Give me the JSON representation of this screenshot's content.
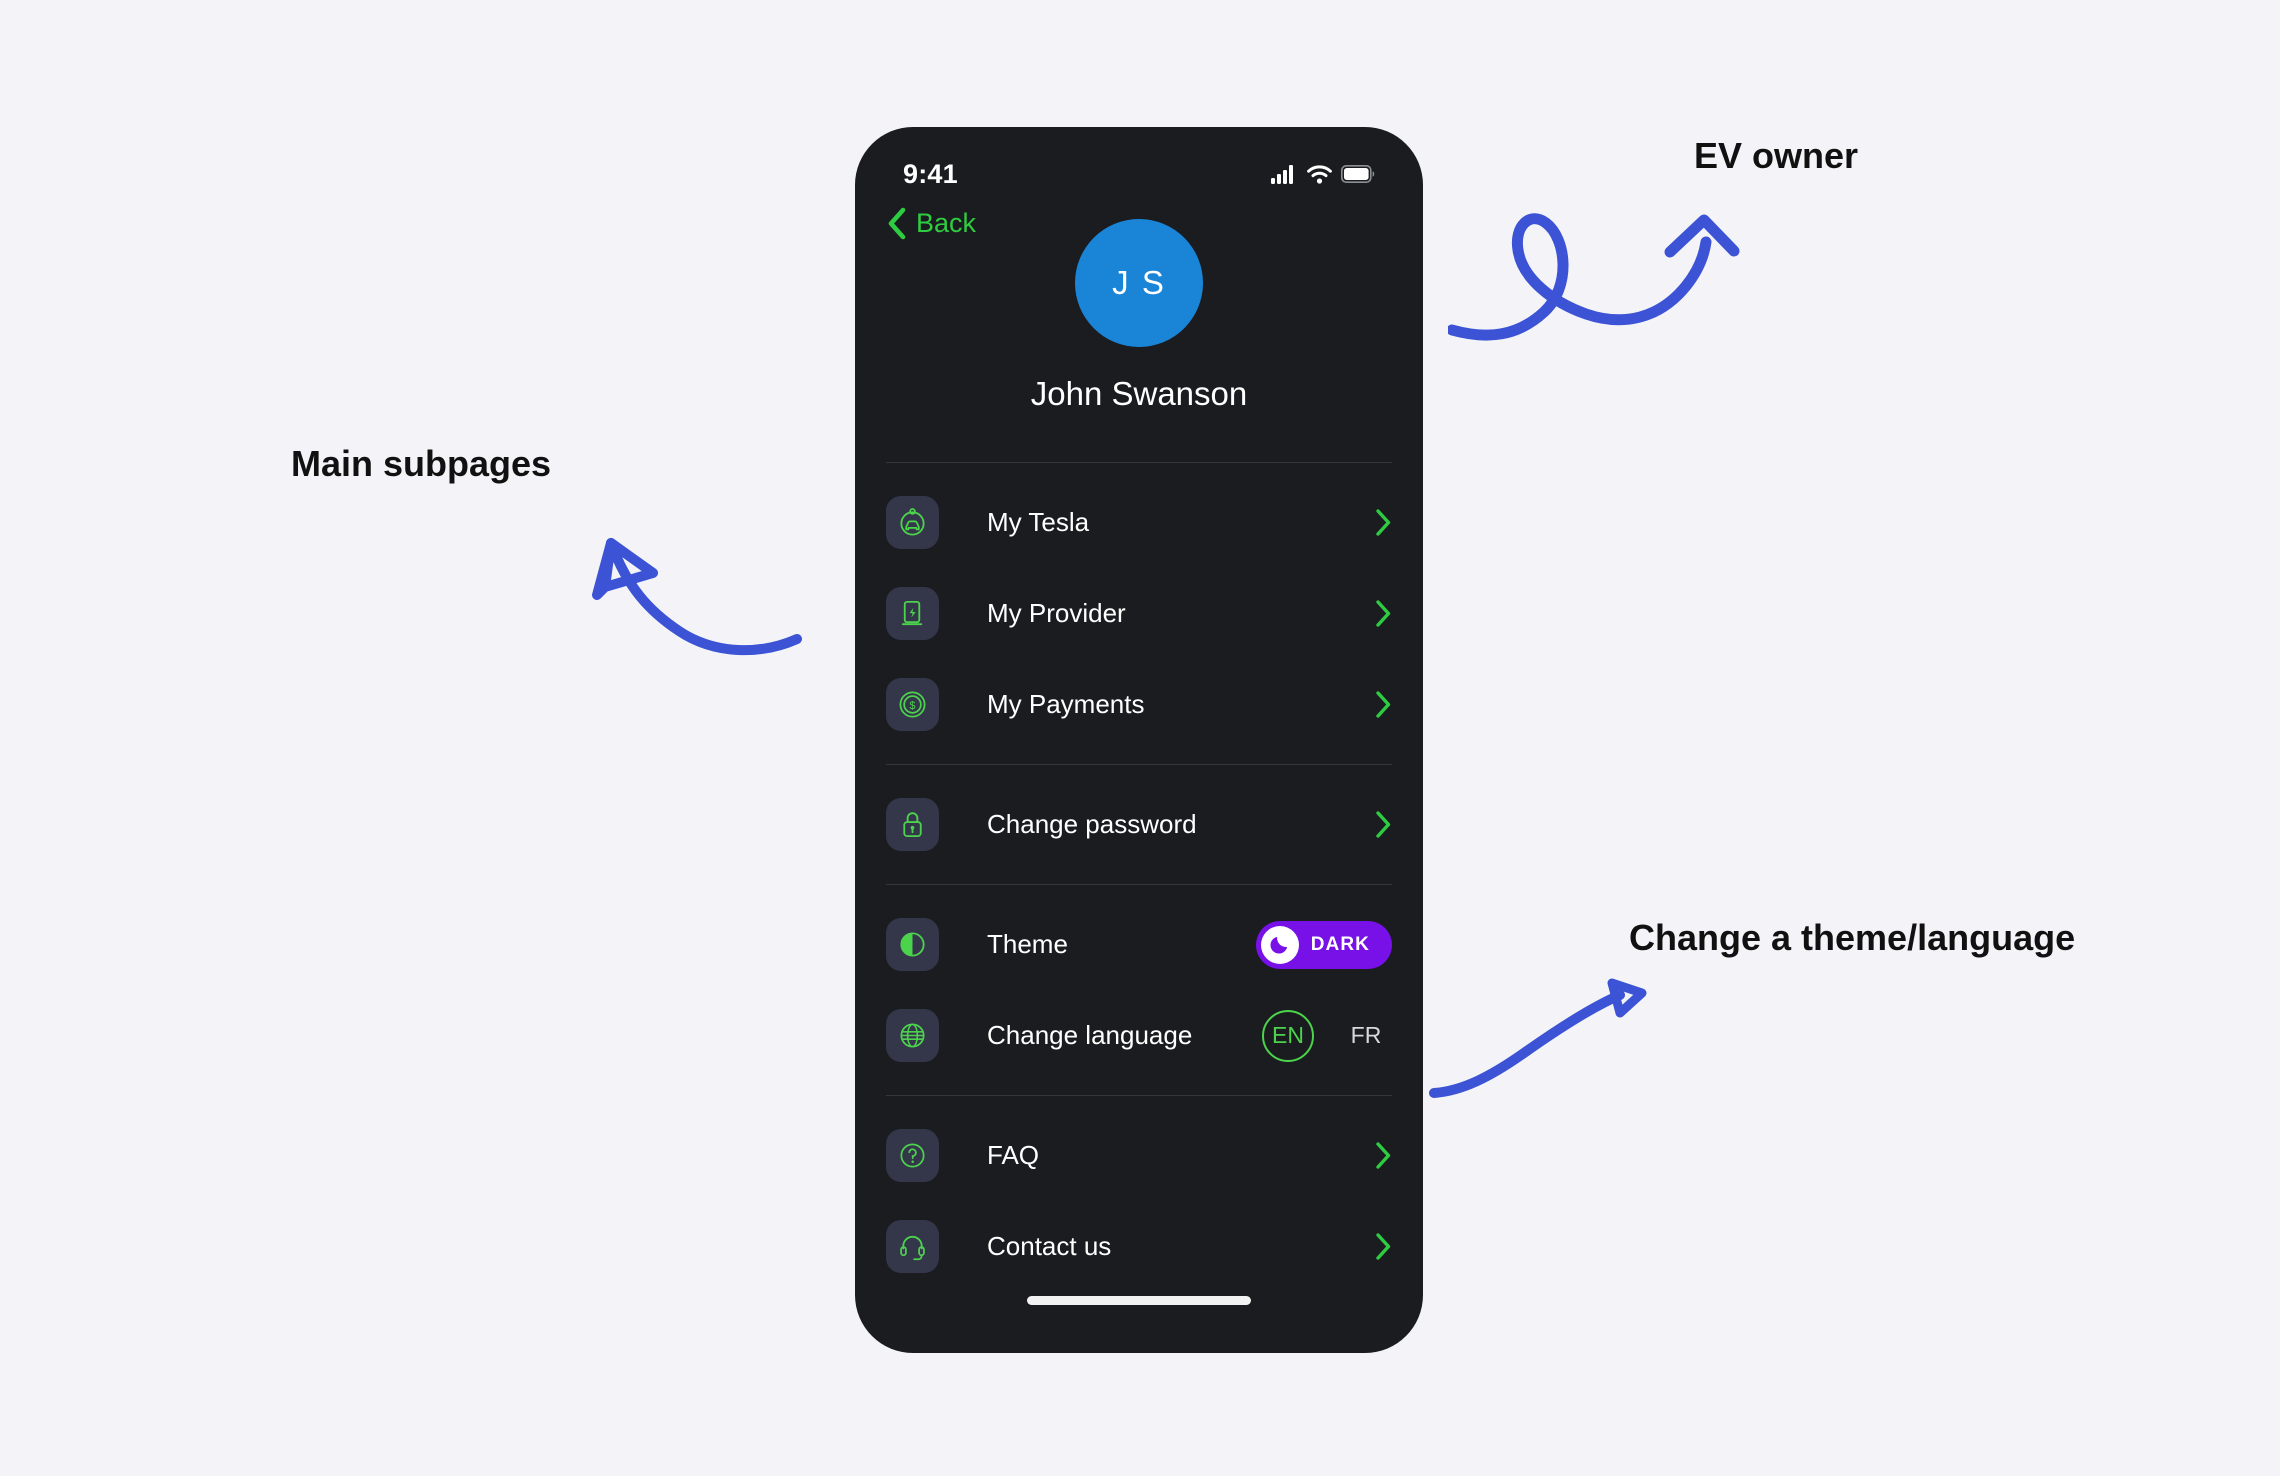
{
  "statusbar": {
    "time": "9:41",
    "icons": [
      "cellular-signal-icon",
      "wifi-icon",
      "battery-icon"
    ]
  },
  "navbar": {
    "back_label": "Back",
    "back_icon": "chevron-left-icon",
    "accent": "#2ecc40"
  },
  "profile": {
    "initials": "J S",
    "name": "John Swanson",
    "avatar_color": "#1a85d6"
  },
  "menu": {
    "groups": [
      {
        "items": [
          {
            "label": "My Tesla",
            "icon": "car-circle-icon",
            "accessory": "chevron-right-icon"
          },
          {
            "label": "My Provider",
            "icon": "charging-station-icon",
            "accessory": "chevron-right-icon"
          },
          {
            "label": "My Payments",
            "icon": "dollar-coin-icon",
            "accessory": "chevron-right-icon"
          }
        ]
      },
      {
        "items": [
          {
            "label": "Change password",
            "icon": "lock-icon",
            "accessory": "chevron-right-icon"
          }
        ]
      },
      {
        "items": [
          {
            "label": "Theme",
            "icon": "contrast-circle-icon",
            "accessory": "theme-toggle"
          },
          {
            "label": "Change language",
            "icon": "globe-icon",
            "accessory": "language-switch"
          }
        ]
      },
      {
        "items": [
          {
            "label": "FAQ",
            "icon": "question-circle-icon",
            "accessory": "chevron-right-icon"
          },
          {
            "label": "Contact us",
            "icon": "headset-icon",
            "accessory": "chevron-right-icon"
          }
        ]
      }
    ]
  },
  "theme_toggle": {
    "value": "DARK",
    "knob_icon": "moon-icon",
    "pill_color": "#7811e8",
    "state": "on"
  },
  "language": {
    "options": [
      "EN",
      "FR"
    ],
    "selected": "EN",
    "active_color": "#4cd34c"
  },
  "annotations": [
    {
      "id": "ev-owner",
      "text": "EV owner",
      "arrow": "loop-arrow-up-right"
    },
    {
      "id": "main-subpages",
      "text": "Main subpages",
      "arrow": "curved-arrow-up-left"
    },
    {
      "id": "theme-language",
      "text": "Change a theme/language",
      "arrow": "curved-arrow-up-right"
    }
  ],
  "colors": {
    "page_background": "#f4f4f8",
    "phone_background": "#1a1c20",
    "icon_tile": "#34364a",
    "icon_green": "#4cd34c",
    "annotation_blue": "#3b53d4"
  }
}
